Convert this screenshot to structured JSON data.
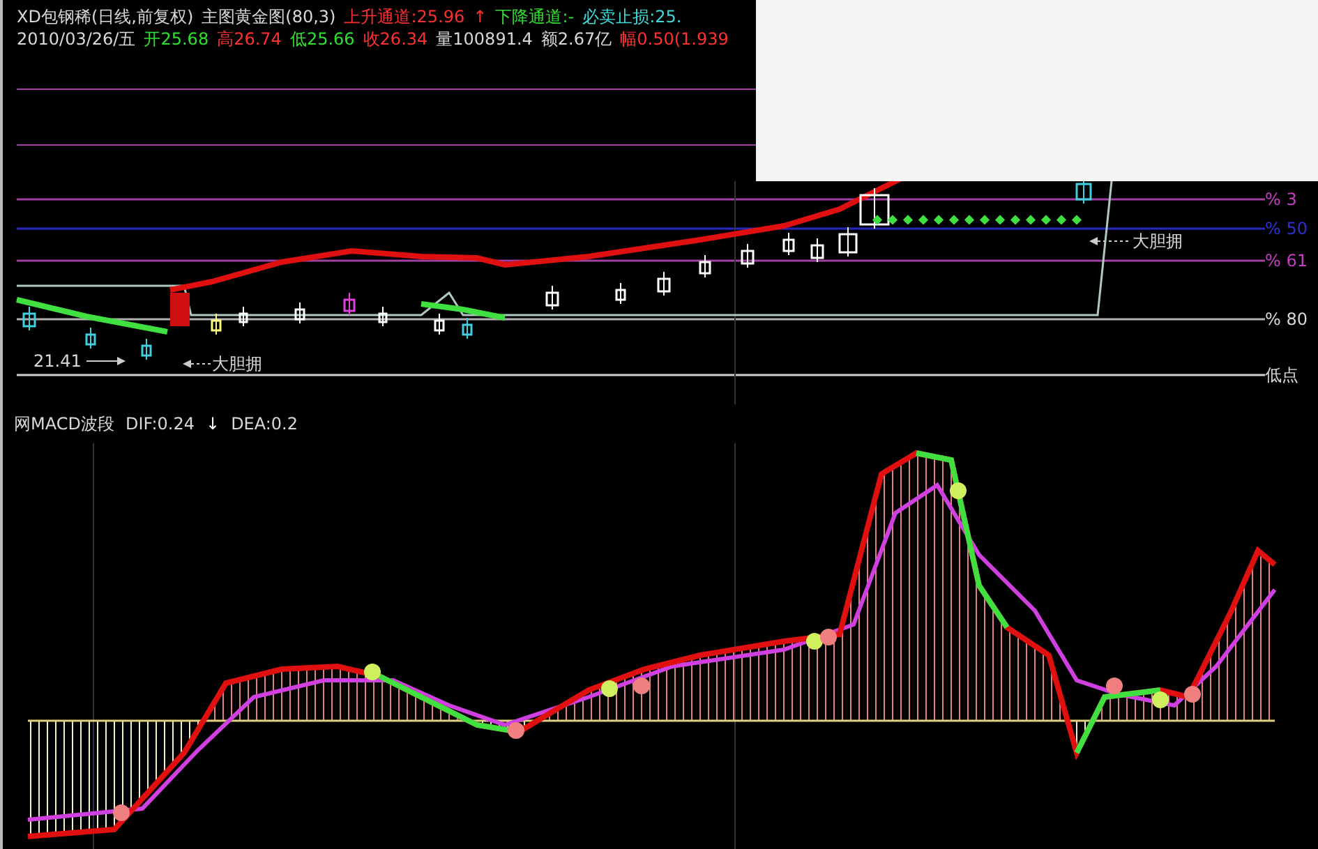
{
  "header_lines": [
    [
      {
        "text": "XD包钢稀(日线,前复权)",
        "color": "#d8d8d8"
      },
      {
        "text": "主图黄金图(80,3)",
        "color": "#d8d8d8"
      },
      {
        "text": "上升通道:25.96",
        "color": "#ff3030"
      },
      {
        "text": "↑",
        "color": "#ff3030"
      },
      {
        "text": "下降通道:-",
        "color": "#30e030"
      },
      {
        "text": "必卖止损:25.",
        "color": "#40d8d8"
      }
    ],
    [
      {
        "text": "2010/03/26/五",
        "color": "#d8d8d8"
      },
      {
        "text": "开25.68",
        "color": "#30e030"
      },
      {
        "text": "高26.74",
        "color": "#ff3030"
      },
      {
        "text": "低25.66",
        "color": "#30e030"
      },
      {
        "text": "收26.34",
        "color": "#ff3030"
      },
      {
        "text": "量100891.4",
        "color": "#d8d8d8"
      },
      {
        "text": "额2.67亿",
        "color": "#d8d8d8"
      },
      {
        "text": "幅0.50(1.939",
        "color": "#ff3030"
      }
    ]
  ],
  "price_chart": {
    "level_labels": [
      {
        "text": "% 3",
        "color": "#c040c0"
      },
      {
        "text": "% 50",
        "color": "#3030d0"
      },
      {
        "text": "% 61",
        "color": "#c040c0"
      },
      {
        "text": "% 80",
        "color": "#d8d8d8"
      },
      {
        "text": "低点",
        "color": "#d8d8d8"
      }
    ],
    "annotations": [
      {
        "text": "21.41"
      },
      {
        "text": "大胆拥"
      },
      {
        "text": "大胆拥"
      }
    ]
  },
  "macd": {
    "title": "网MACD波段",
    "values": [
      {
        "text": "DIF:0.24",
        "color": "#d8d8d8"
      },
      {
        "text": "↓",
        "color": "#ffffff"
      },
      {
        "text": "DEA:0.2",
        "color": "#d8d8d8"
      }
    ]
  }
}
